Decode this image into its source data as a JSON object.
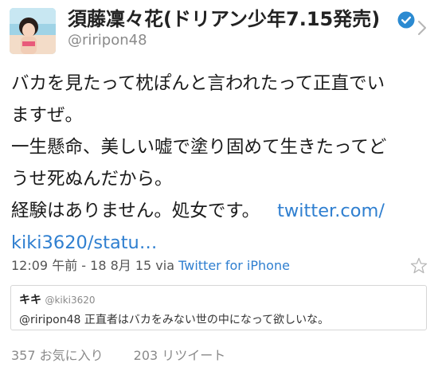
{
  "user": {
    "display_name": "須藤凜々花(ドリアン少年7.15発売)",
    "handle": "@riripon48",
    "verified_icon": "verified-badge-icon"
  },
  "tweet": {
    "text_lines": [
      "バカを見たって枕ぽんと言われたって正直でい",
      "ますぜ。",
      "一生懸命、美しい嘘で塗り固めて生きたってど",
      "うせ死ぬんだから。",
      "経験はありません。処女です。"
    ],
    "link_part1": "twitter.com/",
    "link_part2": "kiki3620/statu…"
  },
  "meta": {
    "timestamp": "12:09 午前 - 18 8月 15 via",
    "via_app": "Twitter for iPhone"
  },
  "quote": {
    "name": "キキ",
    "handle": "@kiki3620",
    "text": "@riripon48 正直者はバカをみない世の中になって欲しいな。"
  },
  "stats": {
    "favorites": "357 お気に入り",
    "retweets": "203 リツイート"
  },
  "colors": {
    "link": "#2f7fd0",
    "verified": "#2b8ad1"
  }
}
